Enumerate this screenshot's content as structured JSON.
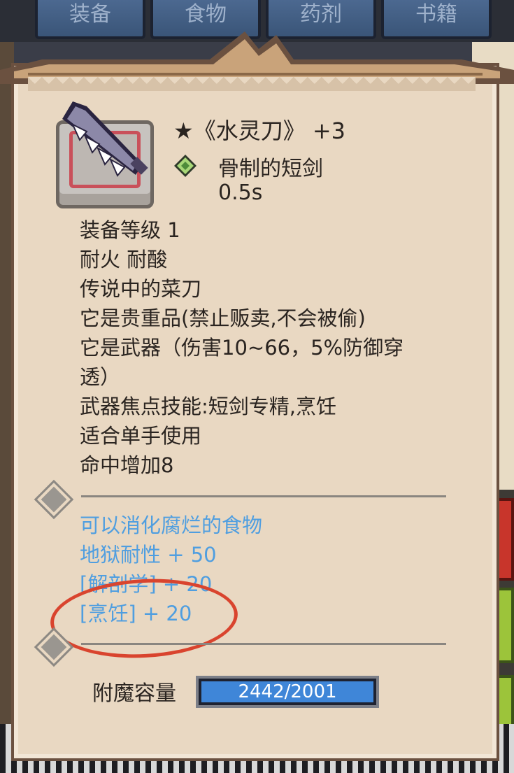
{
  "background_tabs": [
    "装备",
    "食物",
    "药剂",
    "书籍"
  ],
  "item": {
    "title": "★《水灵刀》 +3",
    "subtype": "骨制的短剑",
    "speed": "0.5s",
    "icon": "dagger-icon",
    "gem_icon": "green-gem-icon"
  },
  "stats": [
    "装备等级 1",
    "耐火  耐酸",
    "传说中的菜刀",
    "它是贵重品(禁止贩卖,不会被偷)",
    "它是武器（伤害10~66，5%防御穿",
    "透）",
    "武器焦点技能:短剑专精,烹饪",
    "适合单手使用",
    "命中增加8"
  ],
  "enchantments": [
    "可以消化腐烂的食物",
    "地狱耐性 + 50",
    "[解剖学] + 20",
    "[烹饪] + 20"
  ],
  "capacity": {
    "label": "附魔容量",
    "value_text": "2442/2001",
    "fill_fraction": 1.0
  },
  "colors": {
    "enchant_text": "#4f9ee0",
    "annotation_circle": "#d9442e",
    "parchment": "#e9d8c2"
  }
}
